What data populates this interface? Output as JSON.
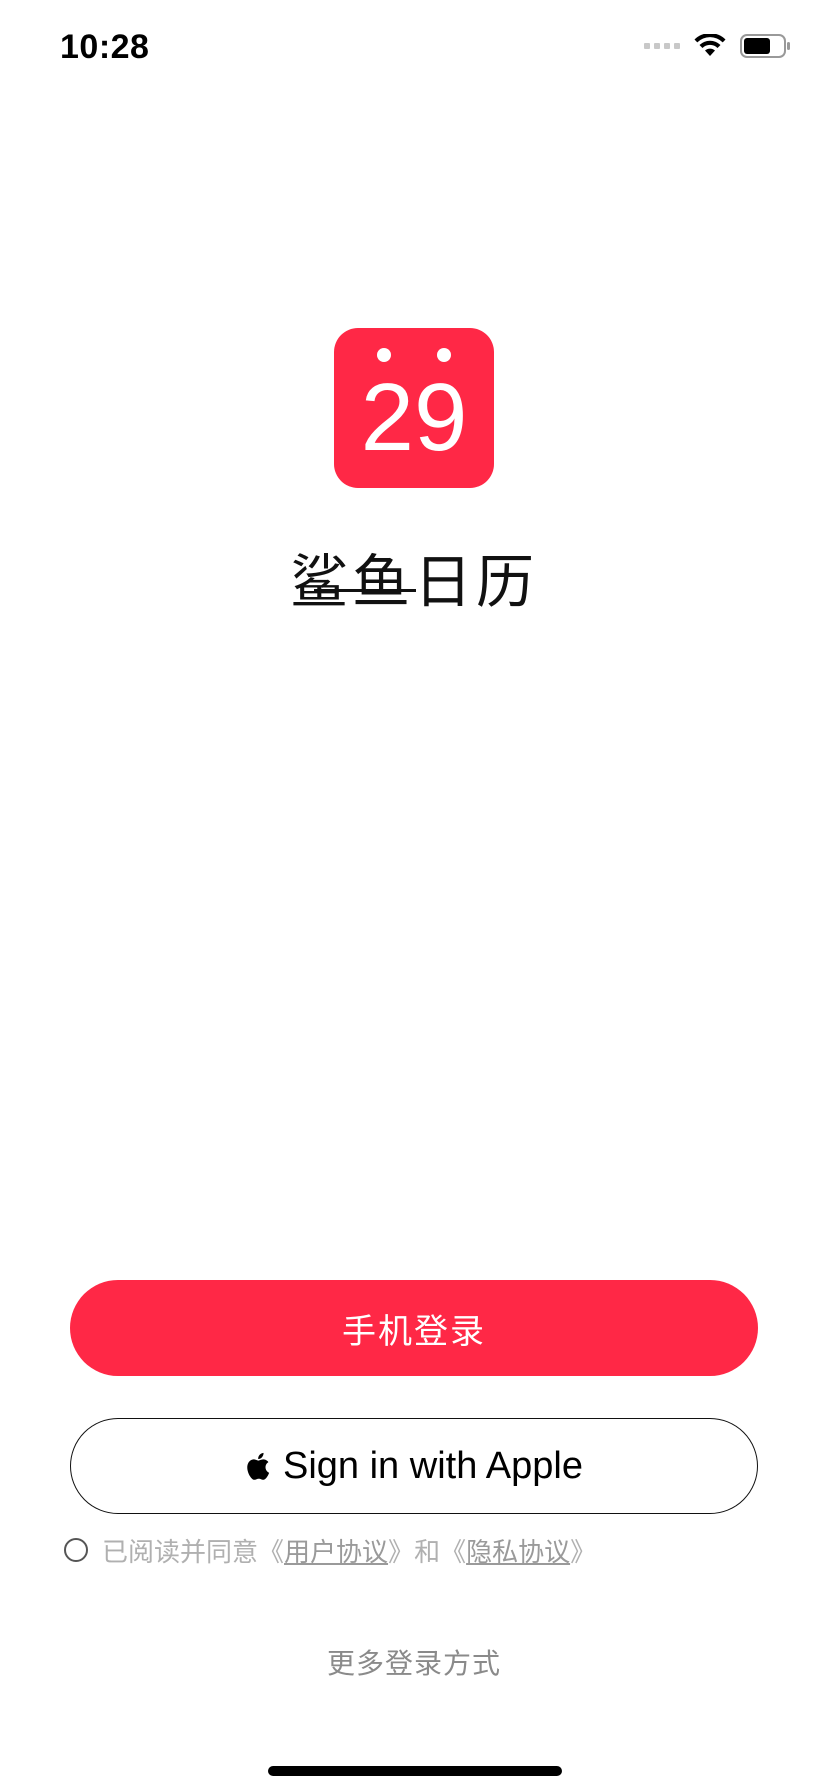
{
  "status_bar": {
    "time": "10:28",
    "icons": [
      "signal-icon",
      "wifi-icon",
      "battery-icon"
    ]
  },
  "app": {
    "logo_number": "29",
    "name": "鲨鱼日历",
    "brand_color": "#ff2846"
  },
  "buttons": {
    "phone_login": "手机登录",
    "apple_login": "Sign in with Apple"
  },
  "agreement": {
    "prefix": "已阅读并同意",
    "open_quote": "《",
    "user_agreement": "用户协议",
    "close_quote": "》",
    "and": "和",
    "privacy_agreement": "隐私协议",
    "checked": false
  },
  "more_login": "更多登录方式"
}
